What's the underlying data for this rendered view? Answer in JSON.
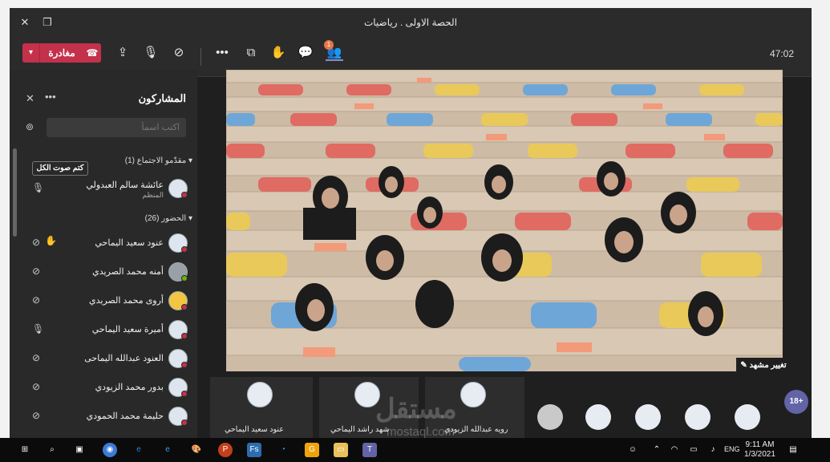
{
  "window": {
    "title": "الحصة الاولى . رياضيات"
  },
  "toolbar": {
    "leave_label": "مغادرة",
    "timer": "47:02",
    "badge_count": "1"
  },
  "panel": {
    "title": "المشاركون",
    "search_placeholder": "اكتب اسماً",
    "mute_all_label": "كتم صوت الكل",
    "presenters_header": "مقدّمو الاجتماع (1)",
    "attendees_header": "الحضور (26)",
    "presenters": [
      {
        "name": "عائشة سالم العبدولي",
        "role": "المنظم"
      }
    ],
    "attendees": [
      {
        "name": "عنود سعيد اليماحي"
      },
      {
        "name": "أمنه محمد الصريدي"
      },
      {
        "name": "أروى محمد الصريدي"
      },
      {
        "name": "أميرة سعيد اليماحي"
      },
      {
        "name": "العنود عبدالله اليماحى"
      },
      {
        "name": "بدور محمد الزيودي"
      },
      {
        "name": "حليمة محمد الحمودي"
      }
    ]
  },
  "video": {
    "change_scene_label": "تغيير مشهد"
  },
  "strip": {
    "names": [
      "عنود سعيد اليماحي",
      "شهد راشد اليماحي",
      "رويه عبدالله الزيودي"
    ],
    "more_count": "18+"
  },
  "watermark": {
    "brand": "مستقل",
    "url": "mostaql.com"
  },
  "taskbar": {
    "lang": "ENG",
    "time": "9:11 AM",
    "date": "1/3/2021"
  },
  "colors": {
    "leave_red": "#c4314b",
    "teams_purple": "#6264a7",
    "badge_orange": "#e97548"
  }
}
